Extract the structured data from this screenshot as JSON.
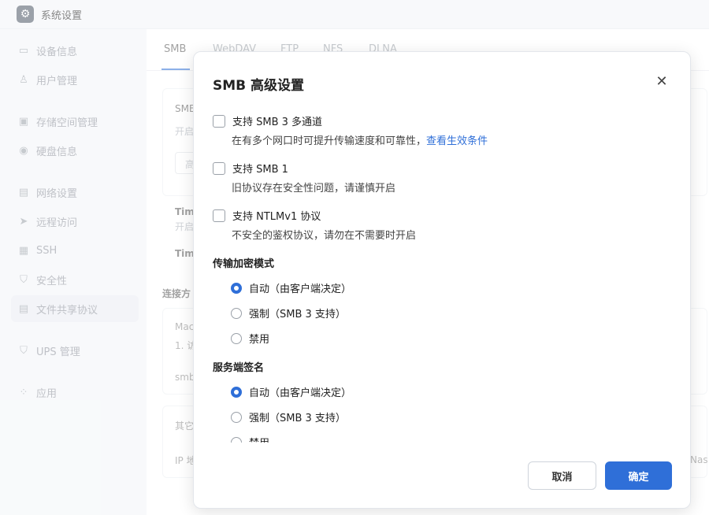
{
  "window": {
    "title": "系统设置",
    "app_icon": "gear-icon"
  },
  "sidebar": {
    "items": [
      {
        "label": "设备信息",
        "icon": "device-icon",
        "glyph": "▭"
      },
      {
        "label": "用户管理",
        "icon": "user-icon",
        "glyph": "♙"
      },
      {
        "label": "存储空间管理",
        "icon": "storage-icon",
        "glyph": "▣"
      },
      {
        "label": "硬盘信息",
        "icon": "disk-icon",
        "glyph": "◉"
      },
      {
        "label": "网络设置",
        "icon": "network-icon",
        "glyph": "▤"
      },
      {
        "label": "远程访问",
        "icon": "send-icon",
        "glyph": "➤"
      },
      {
        "label": "SSH",
        "icon": "terminal-icon",
        "glyph": "▦"
      },
      {
        "label": "安全性",
        "icon": "shield-icon",
        "glyph": "⛉"
      },
      {
        "label": "文件共享协议",
        "icon": "file-share-icon",
        "glyph": "▤"
      },
      {
        "label": "UPS 管理",
        "icon": "ups-icon",
        "glyph": "⛉"
      },
      {
        "label": "应用",
        "icon": "apps-icon",
        "glyph": "⁘"
      }
    ]
  },
  "tabs": [
    "SMB",
    "WebDAV",
    "FTP",
    "NFS",
    "DLNA"
  ],
  "background": {
    "card1_title": "SMB",
    "card1_sub": "开启",
    "card1_btn": "高",
    "row1_bold": "Tim",
    "row1_sub": "开启",
    "row2_bold": "Tim",
    "section": "连接方",
    "card2_line1": "Mac",
    "card2_line2": "1. 访",
    "card2_line3": "smb",
    "card3_line1": "其它",
    "card3_line2": "IP 地",
    "right_text": "Nas"
  },
  "dialog": {
    "title": "SMB 高级设置",
    "options": [
      {
        "label": "支持 SMB 3 多通道",
        "desc": "在有多个网口时可提升传输速度和可靠性，",
        "link": "查看生效条件",
        "checked": false
      },
      {
        "label": "支持 SMB 1",
        "desc": "旧协议存在安全性问题，请谨慎开启",
        "checked": false
      },
      {
        "label": "支持 NTLMv1 协议",
        "desc": "不安全的鉴权协议，请勿在不需要时开启",
        "checked": false
      }
    ],
    "encryption": {
      "title": "传输加密模式",
      "choices": [
        "自动（由客户端决定）",
        "强制（SMB 3 支持）",
        "禁用"
      ],
      "selected": 0
    },
    "signing": {
      "title": "服务端签名",
      "choices": [
        "自动（由客户端决定）",
        "强制（SMB 3 支持）",
        "禁用"
      ],
      "selected": 0
    },
    "cancel_label": "取消",
    "ok_label": "确定"
  },
  "colors": {
    "accent": "#2f6fd8"
  }
}
